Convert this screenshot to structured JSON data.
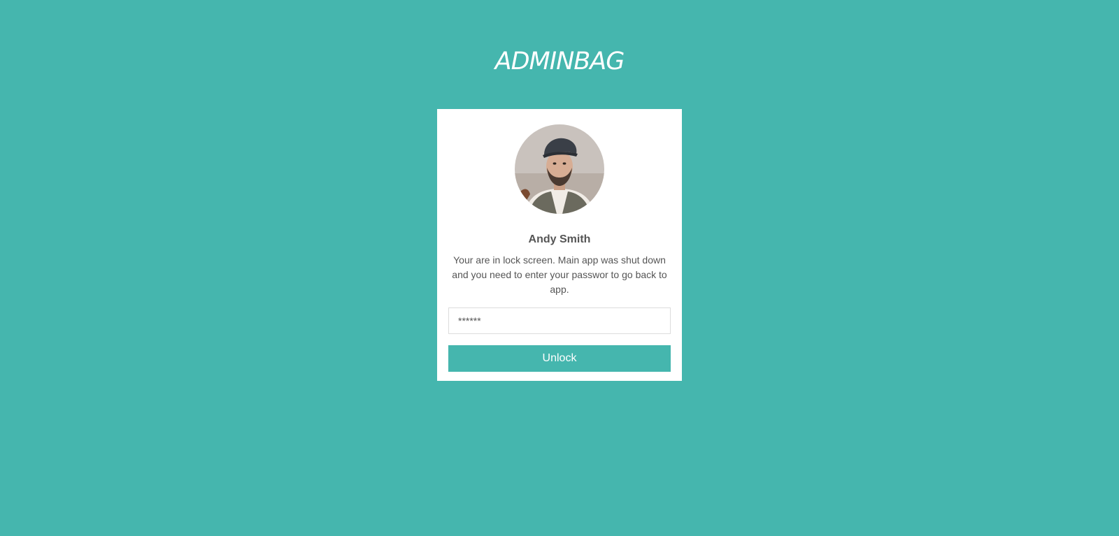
{
  "brand": {
    "logo_text": "ADMINBAG"
  },
  "lock_card": {
    "user_name": "Andy Smith",
    "message": "Your are in lock screen. Main app was shut down and you need to enter your passwor to go back to app.",
    "password_placeholder": "******",
    "unlock_label": "Unlock"
  },
  "colors": {
    "background": "#45b6ae",
    "accent": "#45b6ae",
    "card": "#ffffff",
    "text": "#555555"
  },
  "icons": {
    "avatar": "user-avatar-photo"
  }
}
